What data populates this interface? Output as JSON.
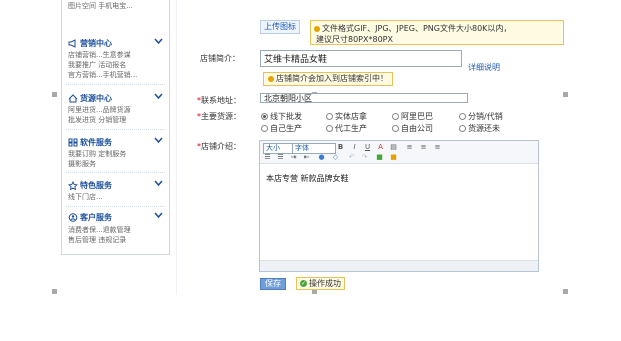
{
  "sidebar": {
    "top_line": "图片空间   手机电宝...",
    "sections": [
      {
        "title": "营销中心",
        "icon": "megaphone-icon",
        "lines": [
          "店铺营销...生意参谋",
          "我要推广    活动报名",
          "官方营销...手机营销..."
        ]
      },
      {
        "title": "货源中心",
        "icon": "home-icon",
        "lines": [
          "阿里进货...品牌货源",
          "批发进货    分销管理"
        ]
      },
      {
        "title": "软件服务",
        "icon": "grid-icon",
        "lines": [
          "我要订购    定制服务",
          "摄影服务"
        ]
      },
      {
        "title": "特色服务",
        "icon": "star-icon",
        "lines": [
          "线下门店..."
        ]
      },
      {
        "title": "客户服务",
        "icon": "customer-service-icon",
        "lines": [
          "消费者保...退款管理",
          "售后管理    违规记录"
        ]
      }
    ]
  },
  "form": {
    "upload_label": "上传图标",
    "upload_tip_line1": "文件格式GIF、JPG、JPEG、PNG文件大小80K以内，",
    "upload_tip_line2": "建议尺寸80PX*80PX",
    "intro_label": "店铺简介：",
    "intro_value": "艾维卡精品女鞋",
    "intro_link": "详细说明",
    "intro_tip": "店铺简介会加入到店铺索引中！",
    "address_label": "联系地址：",
    "address_value": "北京朝阳小区",
    "source_label": "主要货源：",
    "source_options": [
      "线下批发",
      "实体店拿",
      "阿里巴巴",
      "分销/代销",
      "自己生产",
      "代工生产",
      "自由公司",
      "货源还未"
    ],
    "source_selected": 0,
    "desc_label": "店铺介绍：",
    "editor_size": "大小",
    "editor_font": "字体",
    "editor_content": "本店专营  新款品牌女鞋",
    "save_label": "保存",
    "success_msg": "操作成功"
  }
}
